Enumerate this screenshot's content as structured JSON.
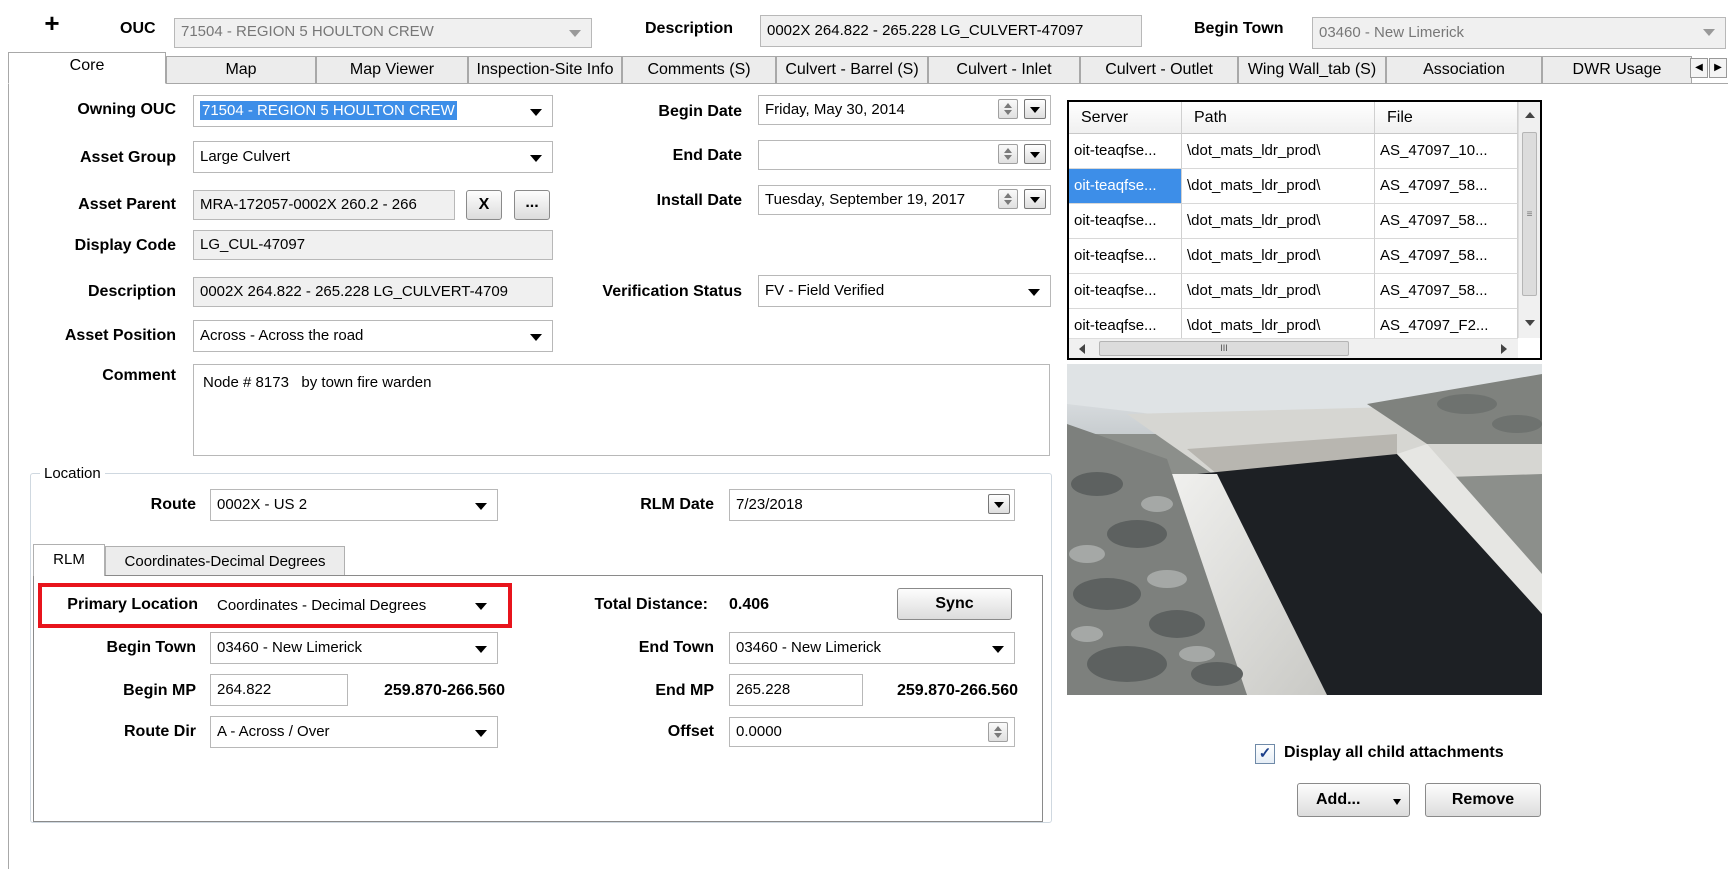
{
  "header": {
    "add_icon": "plus-icon",
    "ouc_label": "OUC",
    "ouc_value": "71504 - REGION 5 HOULTON CREW",
    "description_label": "Description",
    "description_value": "0002X 264.822  - 265.228 LG_CULVERT-47097",
    "begin_town_label": "Begin Town",
    "begin_town_value": "03460 - New Limerick"
  },
  "tabs": [
    "Core",
    "Map",
    "Map Viewer",
    "Inspection-Site Info",
    "Comments (S)",
    "Culvert - Barrel (S)",
    "Culvert - Inlet",
    "Culvert - Outlet",
    "Wing Wall_tab (S)",
    "Association",
    "DWR Usage"
  ],
  "form": {
    "owning_ouc_label": "Owning OUC",
    "owning_ouc_value": "71504 - REGION 5 HOULTON CREW",
    "asset_group_label": "Asset Group",
    "asset_group_value": "Large Culvert",
    "asset_parent_label": "Asset Parent",
    "asset_parent_value": "MRA-172057-0002X 260.2  - 266",
    "clear_button": "X",
    "browse_button": "...",
    "display_code_label": "Display Code",
    "display_code_value": "LG_CUL-47097",
    "description_label": "Description",
    "description_value": "0002X 264.822  - 265.228 LG_CULVERT-4709",
    "asset_position_label": "Asset Position",
    "asset_position_value": "Across - Across the road",
    "comment_label": "Comment",
    "comment_value": "Node # 8173   by town fire warden",
    "begin_date_label": "Begin Date",
    "begin_date_value": "Friday, May 30, 2014",
    "end_date_label": "End Date",
    "end_date_value": "",
    "install_date_label": "Install Date",
    "install_date_value": "Tuesday, September 19, 2017",
    "verification_status_label": "Verification Status",
    "verification_status_value": "FV - Field Verified"
  },
  "location": {
    "group_label": "Location",
    "route_label": "Route",
    "route_value": "0002X - US 2",
    "rlm_date_label": "RLM Date",
    "rlm_date_value": "7/23/2018",
    "subtabs": [
      "RLM",
      "Coordinates-Decimal Degrees"
    ],
    "primary_location_label": "Primary Location",
    "primary_location_value": "Coordinates - Decimal Degrees",
    "total_distance_label": "Total Distance:",
    "total_distance_value": "0.406",
    "sync_button": "Sync",
    "begin_town_label": "Begin Town",
    "begin_town_value": "03460 - New Limerick",
    "end_town_label": "End Town",
    "end_town_value": "03460 - New Limerick",
    "begin_mp_label": "Begin MP",
    "begin_mp_value": "264.822",
    "begin_mp_range": "259.870-266.560",
    "end_mp_label": "End MP",
    "end_mp_value": "265.228",
    "end_mp_range": "259.870-266.560",
    "route_dir_label": "Route Dir",
    "route_dir_value": "A - Across / Over",
    "offset_label": "Offset",
    "offset_value": "0.0000"
  },
  "attachments": {
    "columns": [
      "Server",
      "Path",
      "File"
    ],
    "rows": [
      [
        "oit-teaqfse...",
        "\\dot_mats_ldr_prod\\",
        "AS_47097_10..."
      ],
      [
        "oit-teaqfse...",
        "\\dot_mats_ldr_prod\\",
        "AS_47097_58..."
      ],
      [
        "oit-teaqfse...",
        "\\dot_mats_ldr_prod\\",
        "AS_47097_58..."
      ],
      [
        "oit-teaqfse...",
        "\\dot_mats_ldr_prod\\",
        "AS_47097_58..."
      ],
      [
        "oit-teaqfse...",
        "\\dot_mats_ldr_prod\\",
        "AS_47097_58..."
      ],
      [
        "oit-teaqfse...",
        "\\dot_mats_ldr_prod\\",
        "AS_47097_F2..."
      ]
    ],
    "display_child_label": "Display all child attachments",
    "display_child_checked": true,
    "add_button": "Add...",
    "remove_button": "Remove"
  },
  "colors": {
    "selection": "#3d8ee8",
    "highlight_box": "#e8141c"
  }
}
